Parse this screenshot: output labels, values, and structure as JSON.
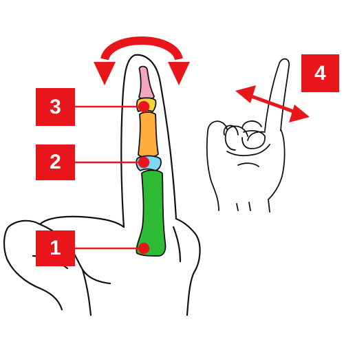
{
  "badges": [
    {
      "label": "1"
    },
    {
      "label": "2"
    },
    {
      "label": "3"
    },
    {
      "label": "4"
    }
  ],
  "colors": {
    "accent": "#e8151b",
    "distal_phalanx": "#f2a6bf",
    "middle_phalanx": "#ffae3d",
    "proximal_phalanx": "#2fbb35",
    "joint_dip": "#f4d33a",
    "joint_pip": "#7fd6ee",
    "outline": "#111111"
  },
  "icons": [
    "rotation-arrow-icon",
    "side-to-side-arrow-icon",
    "small-hand-icon"
  ]
}
